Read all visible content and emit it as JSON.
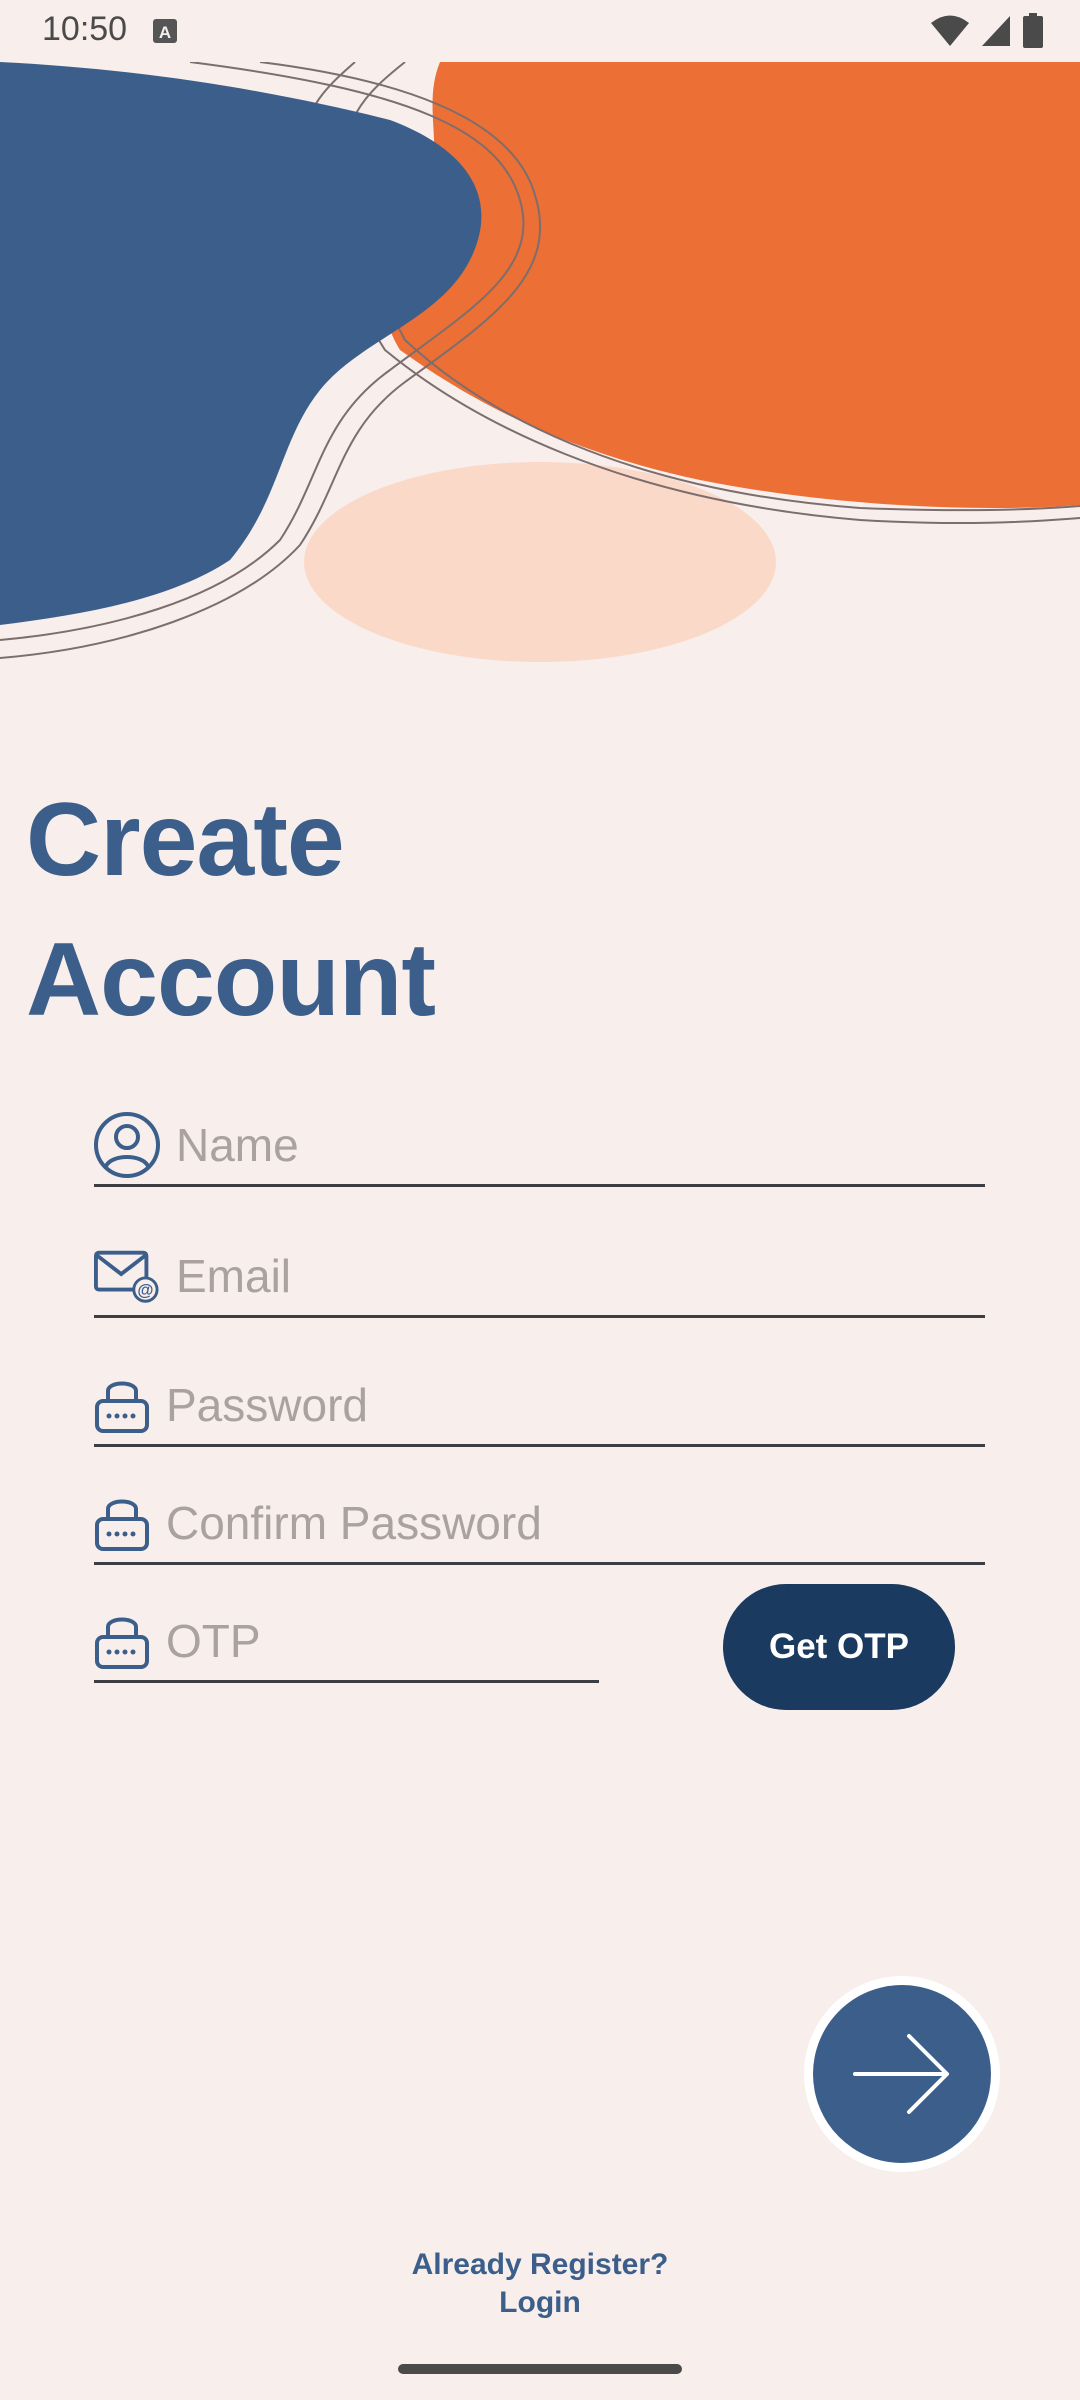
{
  "status_bar": {
    "time": "10:50",
    "icons": [
      "keyboard-a-icon",
      "wifi-icon",
      "signal-icon",
      "battery-icon"
    ]
  },
  "title": {
    "line1": "Create",
    "line2": "Account"
  },
  "form": {
    "name_placeholder": "Name",
    "email_placeholder": "Email",
    "password_placeholder": "Password",
    "confirm_password_placeholder": "Confirm Password",
    "otp_placeholder": "OTP",
    "get_otp_label": "Get OTP"
  },
  "footer": {
    "line1": "Already Register?",
    "line2": "Login"
  },
  "colors": {
    "background": "#f8eeec",
    "primary_blue": "#3b5f8a",
    "dark_blue": "#1b3a5f",
    "orange": "#ec6f36",
    "peach": "#fbd9c8"
  }
}
